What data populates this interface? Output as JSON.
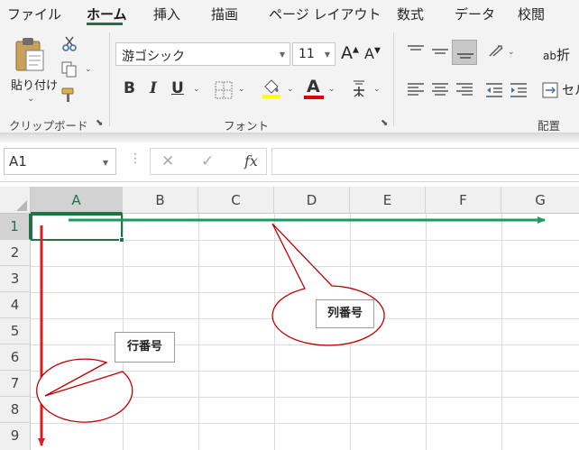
{
  "menu": {
    "tabs": [
      "ファイル",
      "ホーム",
      "挿入",
      "描画",
      "ページ レイアウト",
      "数式",
      "データ",
      "校閲"
    ],
    "active_tab": "ホーム"
  },
  "ribbon": {
    "clipboard": {
      "paste_label": "貼り付け",
      "group_label": "クリップボード"
    },
    "font": {
      "font_name": "游ゴシック",
      "font_size": "11",
      "bold": "B",
      "italic": "I",
      "underline": "U",
      "font_color_letter": "A",
      "grow_font": "A",
      "shrink_font": "A",
      "group_label": "フォント"
    },
    "alignment": {
      "wrap_label": "折",
      "merge_label": "セル",
      "group_label": "配置"
    }
  },
  "formula_bar": {
    "name_box": "A1",
    "fx": "fx",
    "formula_value": ""
  },
  "sheet": {
    "columns": [
      "A",
      "B",
      "C",
      "D",
      "E",
      "F",
      "G"
    ],
    "rows": [
      "1",
      "2",
      "3",
      "4",
      "5",
      "6",
      "7",
      "8",
      "9"
    ],
    "selected_column": "A",
    "selected_row": "1"
  },
  "annotations": {
    "column_callout": "列番号",
    "row_callout": "行番号"
  },
  "colors": {
    "accent_green": "#217346",
    "column_arrow": "#1a9c5b",
    "row_arrow": "#d42020",
    "callout_outline": "#c00000",
    "font_color_bar": "#e00000",
    "highlight_bar": "#ffff00"
  }
}
